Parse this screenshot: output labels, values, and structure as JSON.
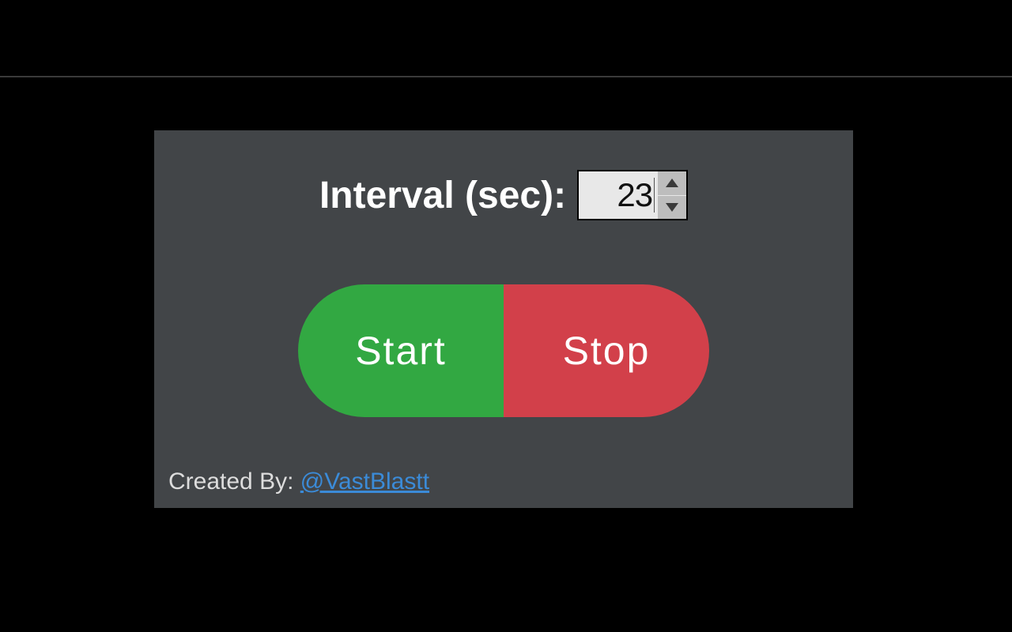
{
  "interval": {
    "label": "Interval (sec):",
    "value": "23"
  },
  "buttons": {
    "start": "Start",
    "stop": "Stop"
  },
  "credits": {
    "prefix": "Created By: ",
    "handle": "@VastBlastt"
  },
  "colors": {
    "panel": "#424548",
    "start": "#32a842",
    "stop": "#d2404a",
    "link": "#3b8bd8"
  }
}
